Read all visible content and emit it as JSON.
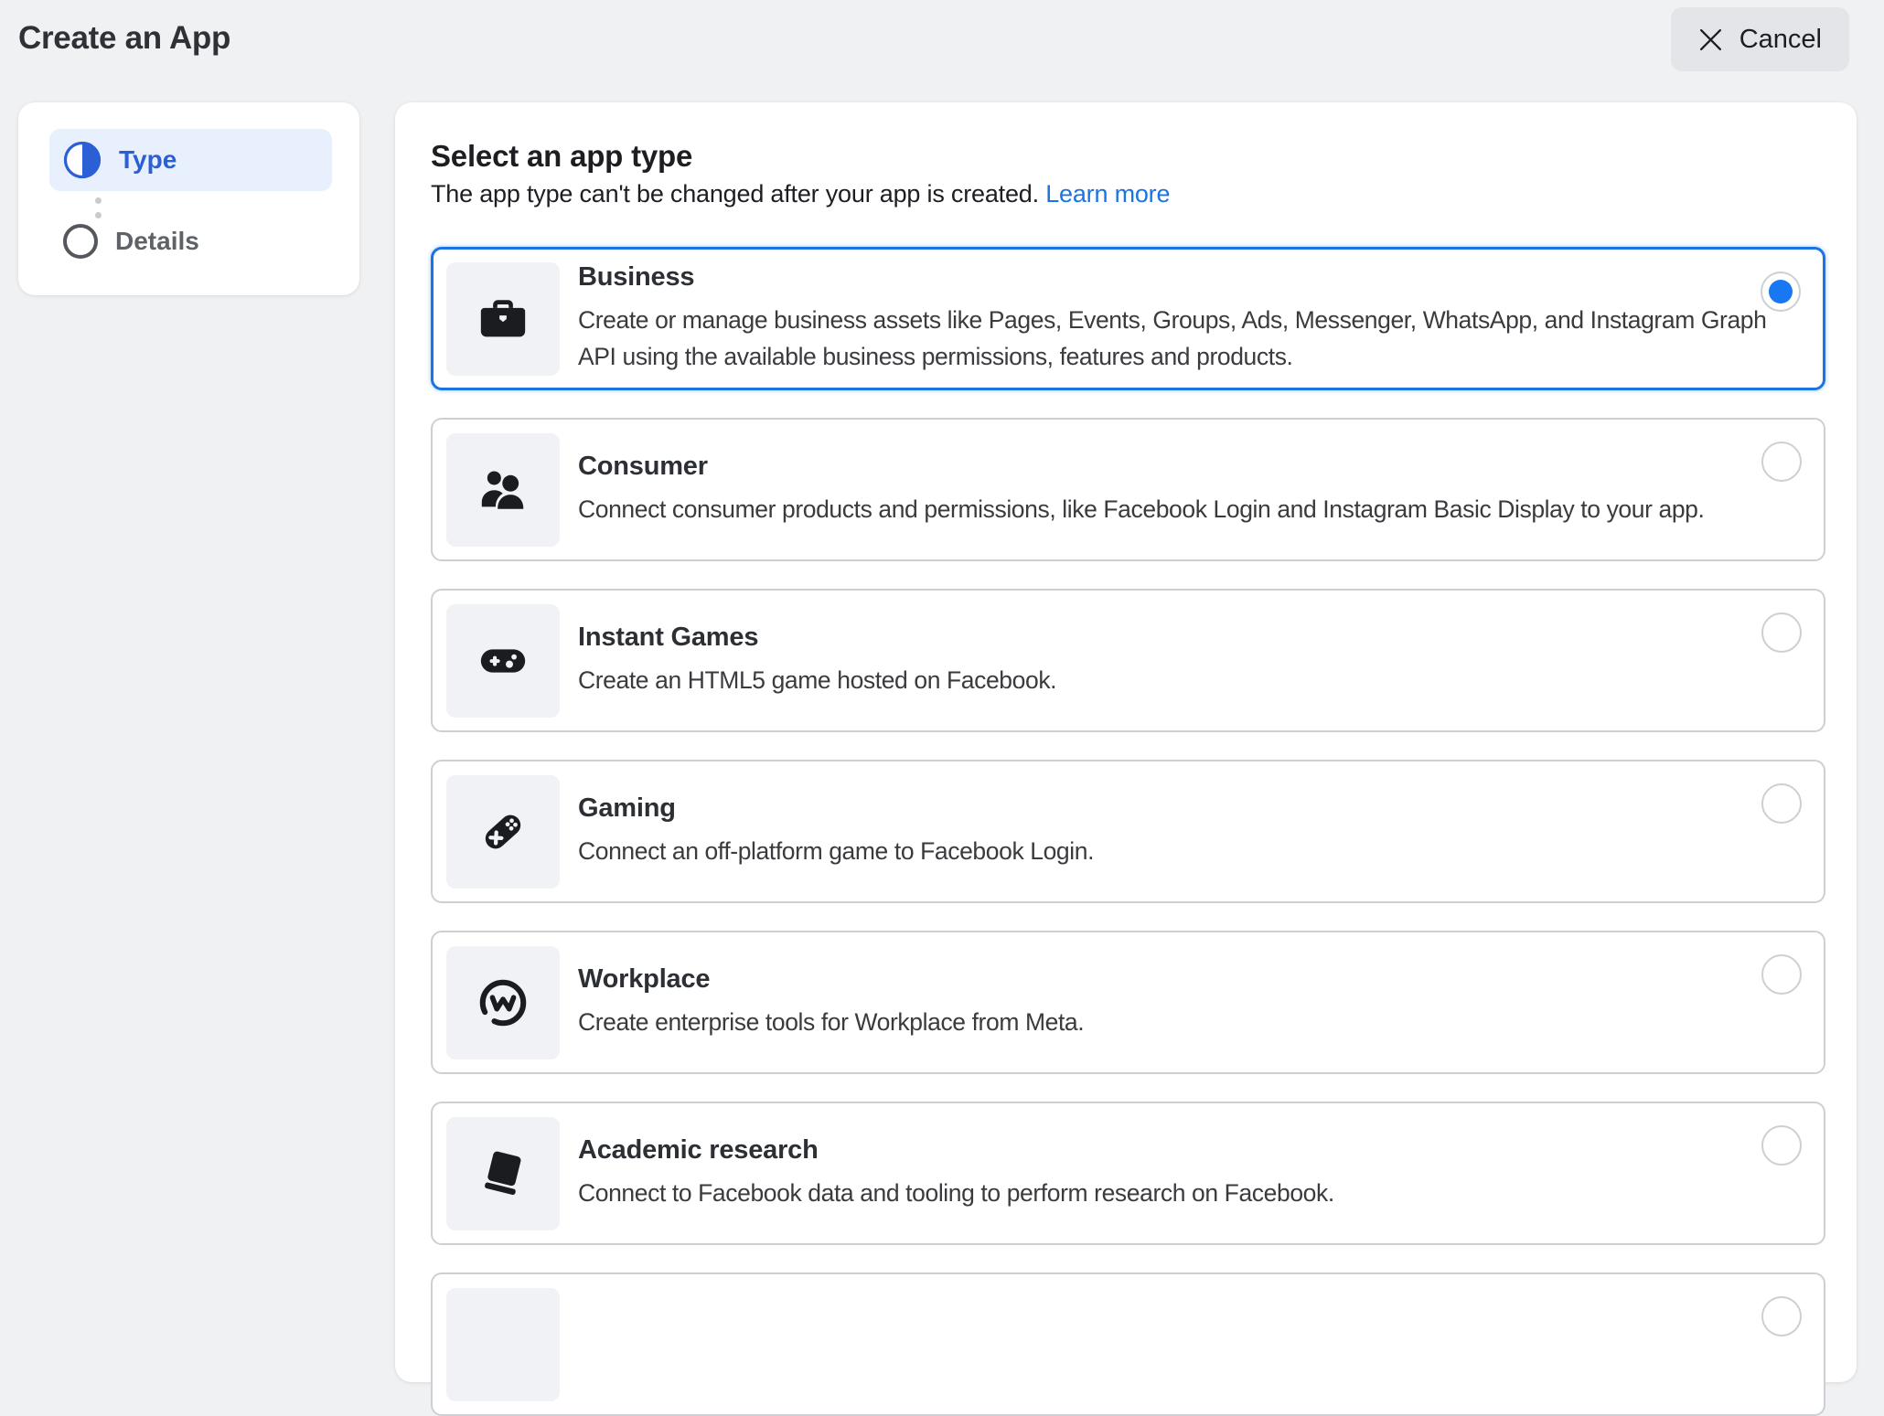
{
  "topbar": {
    "title": "Create an App",
    "cancel_label": "Cancel"
  },
  "stepper": {
    "steps": [
      {
        "label": "Type",
        "state": "active"
      },
      {
        "label": "Details",
        "state": "upcoming"
      }
    ]
  },
  "main": {
    "heading": "Select an app type",
    "subtext": "The app type can't be changed after your app is created.",
    "learn_more_label": "Learn more",
    "options": [
      {
        "label": "Business",
        "description": "Create or manage business assets like Pages, Events, Groups, Ads, Messenger, WhatsApp, and Instagram Graph API using the available business permissions, features and products.",
        "icon": "briefcase-icon",
        "selected": true
      },
      {
        "label": "Consumer",
        "description": "Connect consumer products and permissions, like Facebook Login and Instagram Basic Display to your app.",
        "icon": "people-icon",
        "selected": false
      },
      {
        "label": "Instant Games",
        "description": "Create an HTML5 game hosted on Facebook.",
        "icon": "instant-games-controller-icon",
        "selected": false
      },
      {
        "label": "Gaming",
        "description": "Connect an off-platform game to Facebook Login.",
        "icon": "gamepad-icon",
        "selected": false
      },
      {
        "label": "Workplace",
        "description": "Create enterprise tools for Workplace from Meta.",
        "icon": "workplace-circle-w-icon",
        "selected": false
      },
      {
        "label": "Academic research",
        "description": "Connect to Facebook data and tooling to perform research on Facebook.",
        "icon": "book-icon",
        "selected": false
      }
    ],
    "partial_option_visible": true
  },
  "colors": {
    "accent_blue": "#1b74e4",
    "radio_blue": "#1877f2",
    "step_blue": "#2a5fd6",
    "step_pill_bg": "#e8f0fe",
    "card_border": "#ccd0d5",
    "page_bg": "#f0f1f3",
    "panel_bg": "#ffffff",
    "icon_tile_bg": "#f0f2f5",
    "text_dark": "#1c1e21",
    "text_gray": "#5f6368"
  }
}
